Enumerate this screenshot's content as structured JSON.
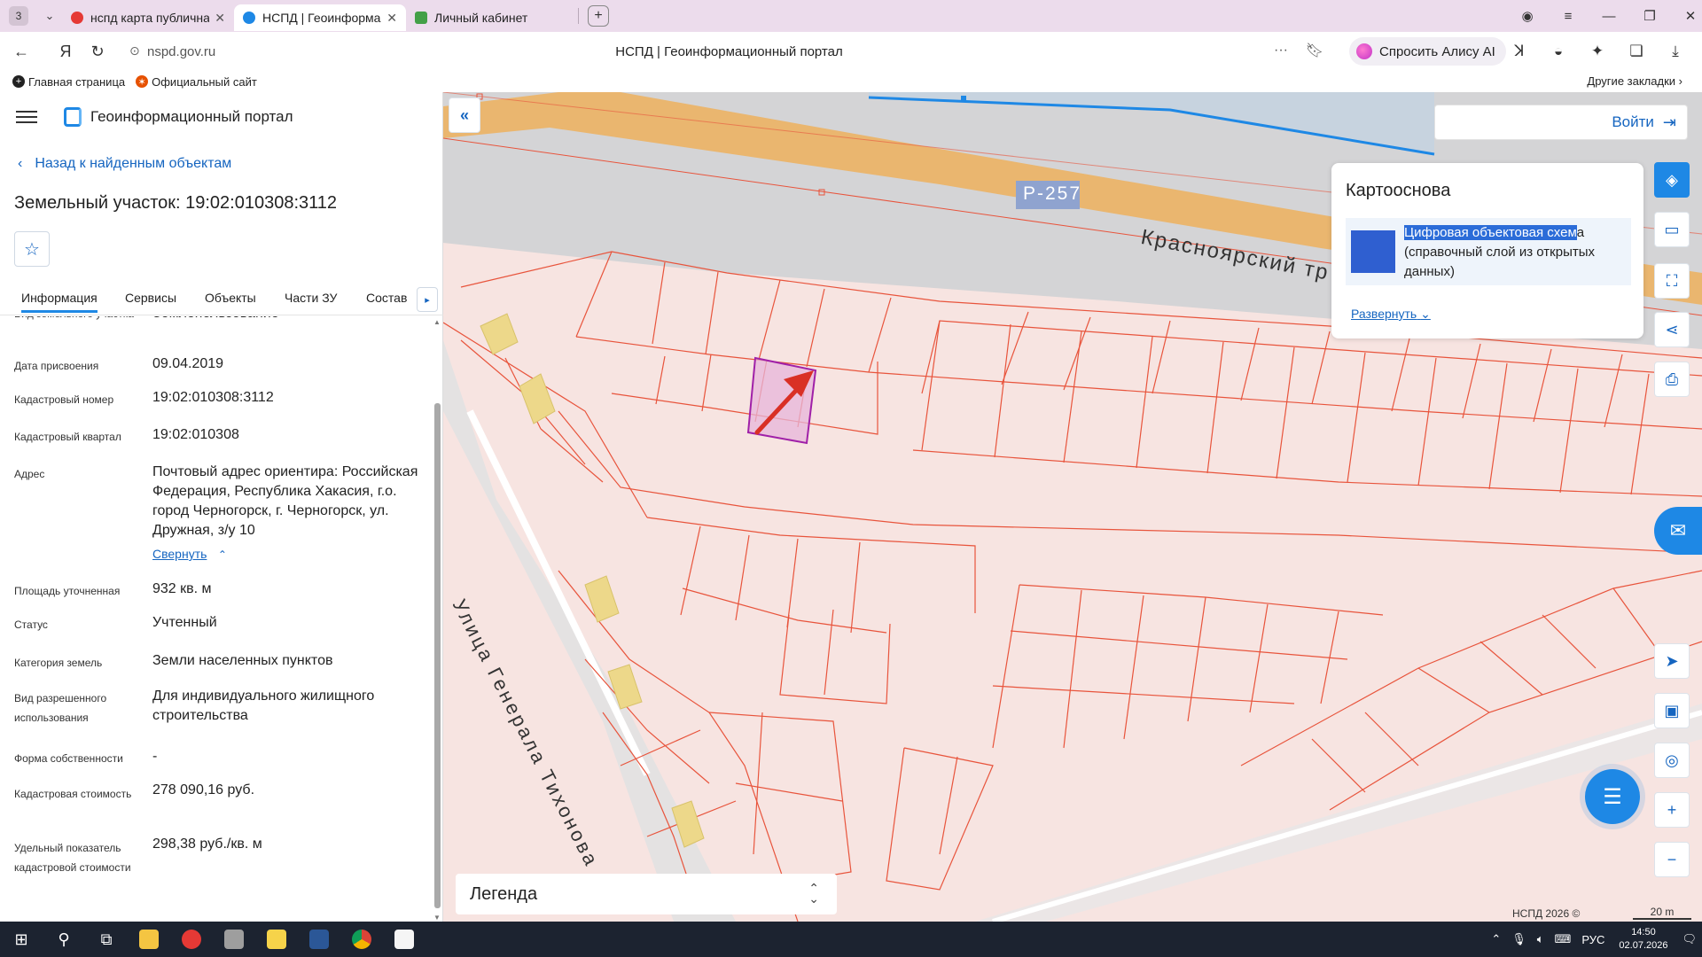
{
  "browser": {
    "tab_count": "3",
    "tabs": [
      {
        "title": "нспд карта публичная кадастровая",
        "favicon_color": "#e53935"
      },
      {
        "title": "НСПД | Геоинформационный портал",
        "favicon_color": "#1e88e5"
      },
      {
        "title": "Личный кабинет",
        "favicon_color": "#43a047"
      }
    ],
    "url": "nspd.gov.ru",
    "page_title": "НСПД | Геоинформационный портал",
    "alice_label": "Спросить Алису AI",
    "bookmarks": [
      "Главная страница",
      "Официальный сайт"
    ],
    "other_bookmarks": "Другие закладки"
  },
  "panel": {
    "portal_name": "Геоинформационный портал",
    "back_label": "Назад к найденным объектам",
    "title": "Земельный участок: 19:02:010308:3112",
    "tabs": [
      "Информация",
      "Сервисы",
      "Объекты",
      "Части ЗУ",
      "Состав"
    ],
    "rows": [
      {
        "label": "Вид земельного участка",
        "value": "Землепользование"
      },
      {
        "label": "Дата присвоения",
        "value": "09.04.2019"
      },
      {
        "label": "Кадастровый номер",
        "value": "19:02:010308:3112"
      },
      {
        "label": "Кадастровый квартал",
        "value": "19:02:010308"
      },
      {
        "label": "Адрес",
        "value": "Почтовый адрес ориентира: Российская Федерация, Республика Хакасия, г.о. город Черногорск, г. Черногорск, ул. Дружная, з/у 10",
        "toggle": "Свернуть"
      },
      {
        "label": "Площадь уточненная",
        "value": "932 кв. м"
      },
      {
        "label": "Статус",
        "value": "Учтенный"
      },
      {
        "label": "Категория земель",
        "value": "Земли населенных пунктов"
      },
      {
        "label": "Вид разрешенного использования",
        "value": "Для индивидуального жилищного строительства"
      },
      {
        "label": "Форма собственности",
        "value": "-"
      },
      {
        "label": "Кадастровая стоимость",
        "value": "278 090,16 руб."
      },
      {
        "label": "Удельный показатель кадастровой стоимости",
        "value": "298,38 руб./кв. м"
      }
    ]
  },
  "map": {
    "login_label": "Войти",
    "basemap_title": "Картооснова",
    "layer_name_selected": "Цифровая объектовая схем",
    "layer_name_rest": "а (справочный слой из открытых данных)",
    "expand_label": "Развернуть",
    "legend_label": "Легенда",
    "road_code": "Р-257",
    "road_name": "Красноярский тр",
    "street_name": "Улица Генерала Тихонова",
    "copyright": "НСПД 2026 ©",
    "scale": "20 m",
    "colors": {
      "parcel_fill": "#f7e4e1",
      "parcel_line": "#e8543c",
      "road_gray": "#d4d4d6",
      "highway": "#e8b46d",
      "selected_parcel": "#a020a8",
      "accent": "#1e88e5"
    }
  },
  "taskbar": {
    "lang": "РУС",
    "time": "14:50",
    "date": "02.07.2026"
  }
}
